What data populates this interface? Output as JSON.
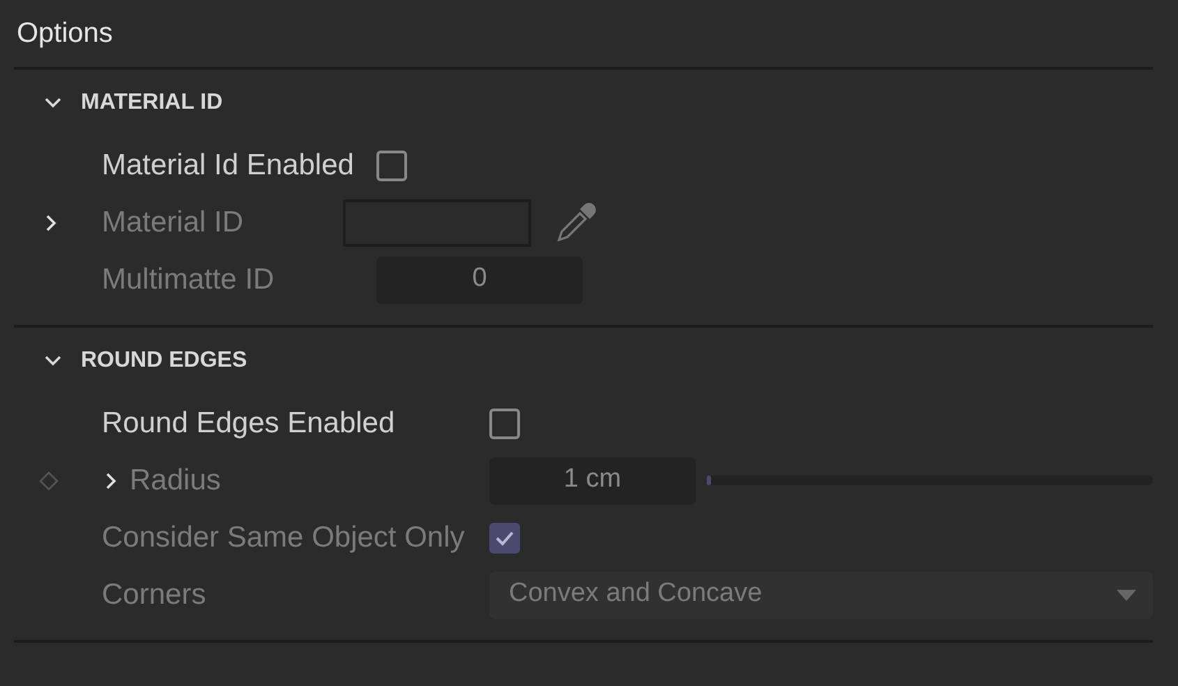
{
  "title": "Options",
  "sections": [
    {
      "title": "MATERIAL ID",
      "expanded": true,
      "rows": [
        {
          "kind": "checkbox",
          "label": "Material Id Enabled",
          "disabled": false,
          "checked": false
        },
        {
          "kind": "link",
          "label": "Material ID",
          "disabled": true,
          "expanded": false
        },
        {
          "kind": "number",
          "label": "Multimatte ID",
          "disabled": true,
          "value": "0"
        }
      ]
    },
    {
      "title": "ROUND EDGES",
      "expanded": true,
      "rows": [
        {
          "kind": "checkbox",
          "label": "Round Edges Enabled",
          "disabled": false,
          "checked": false
        },
        {
          "kind": "slider",
          "label": "Radius",
          "disabled": true,
          "expanded": false,
          "value": "1 cm",
          "level": 0
        },
        {
          "kind": "checkbox",
          "label": "Consider Same Object Only",
          "disabled": true,
          "checked": true
        },
        {
          "kind": "dropdown",
          "label": "Corners",
          "disabled": true,
          "value": "Convex and Concave"
        }
      ]
    }
  ]
}
